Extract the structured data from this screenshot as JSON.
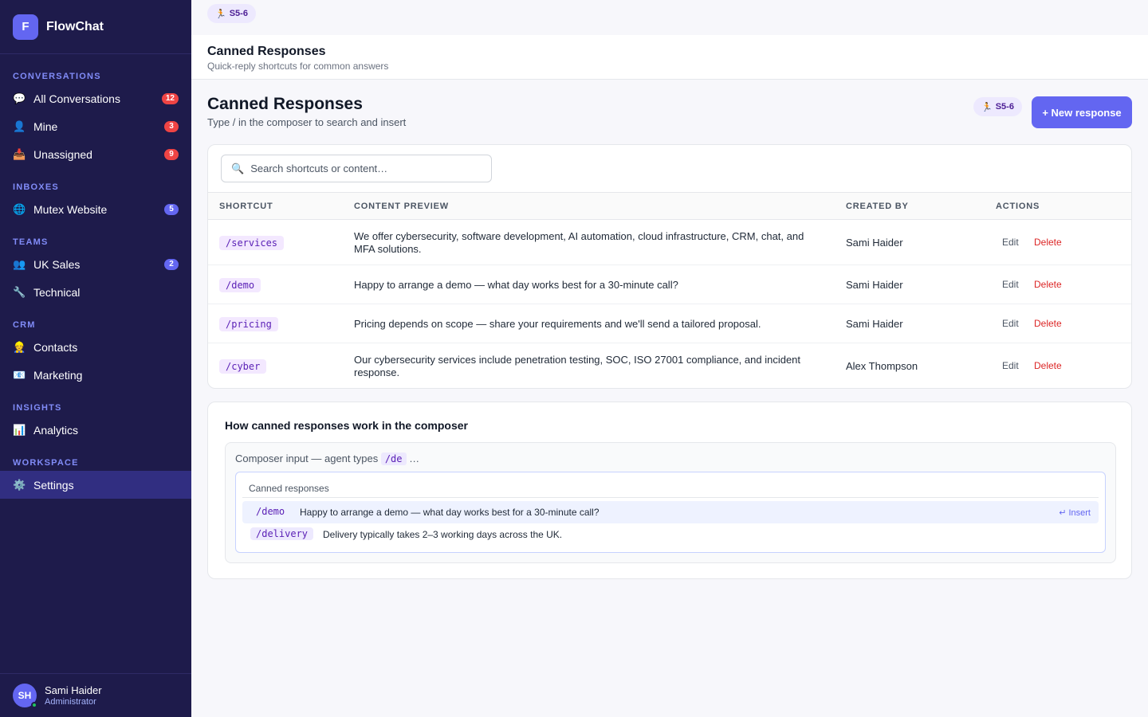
{
  "app": {
    "logo_letter": "F",
    "name": "FlowChat"
  },
  "sidebar": {
    "sections": {
      "conversations": "CONVERSATIONS",
      "inboxes": "INBOXES",
      "teams": "TEAMS",
      "crm": "CRM",
      "insights": "INSIGHTS",
      "workspace": "WORKSPACE"
    },
    "items": {
      "all_conversations": {
        "icon": "💬",
        "label": "All Conversations",
        "badge": "12"
      },
      "mine": {
        "icon": "👤",
        "label": "Mine",
        "badge": "3"
      },
      "unassigned": {
        "icon": "📥",
        "label": "Unassigned",
        "badge": "9"
      },
      "mutex_website": {
        "icon": "🌐",
        "label": "Mutex Website",
        "badge": "5"
      },
      "uk_sales": {
        "icon": "👥",
        "label": "UK Sales",
        "badge": "2"
      },
      "technical": {
        "icon": "🔧",
        "label": "Technical"
      },
      "contacts": {
        "icon": "👷",
        "label": "Contacts"
      },
      "marketing": {
        "icon": "📧",
        "label": "Marketing"
      },
      "analytics": {
        "icon": "📊",
        "label": "Analytics"
      },
      "settings": {
        "icon": "⚙️",
        "label": "Settings"
      }
    },
    "user": {
      "initials": "SH",
      "name": "Sami Haider",
      "role": "Administrator"
    }
  },
  "top_chip": {
    "icon": "🏃",
    "label": "S5-6"
  },
  "page_header": {
    "title": "Canned Responses",
    "subtitle": "Quick-reply shortcuts for common answers"
  },
  "main": {
    "title": "Canned Responses",
    "subtitle": "Type / in the composer to search and insert",
    "chip": {
      "icon": "🏃",
      "label": "S5-6"
    },
    "new_button": "+ New response",
    "search_placeholder": "Search shortcuts or content…",
    "columns": {
      "shortcut": "SHORTCUT",
      "content": "CONTENT PREVIEW",
      "created_by": "CREATED BY",
      "actions": "ACTIONS"
    },
    "edit_label": "Edit",
    "delete_label": "Delete",
    "rows": [
      {
        "shortcut": "/services",
        "content": "We offer cybersecurity, software development, AI automation, cloud infrastructure, CRM, chat, and MFA solutions.",
        "created_by": "Sami Haider"
      },
      {
        "shortcut": "/demo",
        "content": "Happy to arrange a demo — what day works best for a 30-minute call?",
        "created_by": "Sami Haider"
      },
      {
        "shortcut": "/pricing",
        "content": "Pricing depends on scope — share your requirements and we'll send a tailored proposal.",
        "created_by": "Sami Haider"
      },
      {
        "shortcut": "/cyber",
        "content": "Our cybersecurity services include penetration testing, SOC, ISO 27001 compliance, and incident response.",
        "created_by": "Alex Thompson"
      }
    ]
  },
  "howto": {
    "title": "How canned responses work in the composer",
    "composer_label_prefix": "Composer input — agent types ",
    "composer_typed": "/de",
    "composer_label_suffix": "…",
    "popup_title": "Canned responses",
    "suggestions": [
      {
        "shortcut": "/demo",
        "text": "Happy to arrange a demo — what day works best for a 30-minute call?",
        "insert": "↵ Insert"
      },
      {
        "shortcut": "/delivery",
        "text": "Delivery typically takes 2–3 working days across the UK."
      }
    ]
  }
}
